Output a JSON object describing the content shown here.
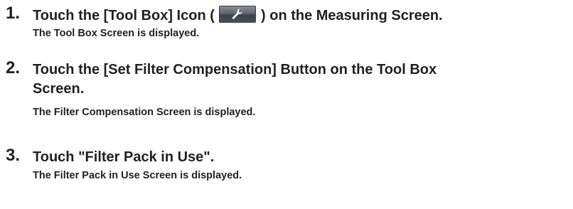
{
  "steps": [
    {
      "number": "1.",
      "title_before_icon": "Touch the [Tool Box] Icon ( ",
      "title_icon": "wrench-icon",
      "title_after_icon": " ) on the Measuring Screen.",
      "result": "The Tool Box Screen is displayed."
    },
    {
      "number": "2.",
      "title_line1": "Touch the [Set Filter Compensation] Button on the Tool Box",
      "title_line2": "Screen.",
      "result": "The Filter Compensation Screen is displayed."
    },
    {
      "number": "3.",
      "title": "Touch \"Filter Pack in Use\".",
      "result": "The Filter Pack in Use Screen is displayed."
    }
  ],
  "colors": {
    "text": "#231f20",
    "icon_background": "#5f656c",
    "icon_glyph": "#ffffff"
  }
}
